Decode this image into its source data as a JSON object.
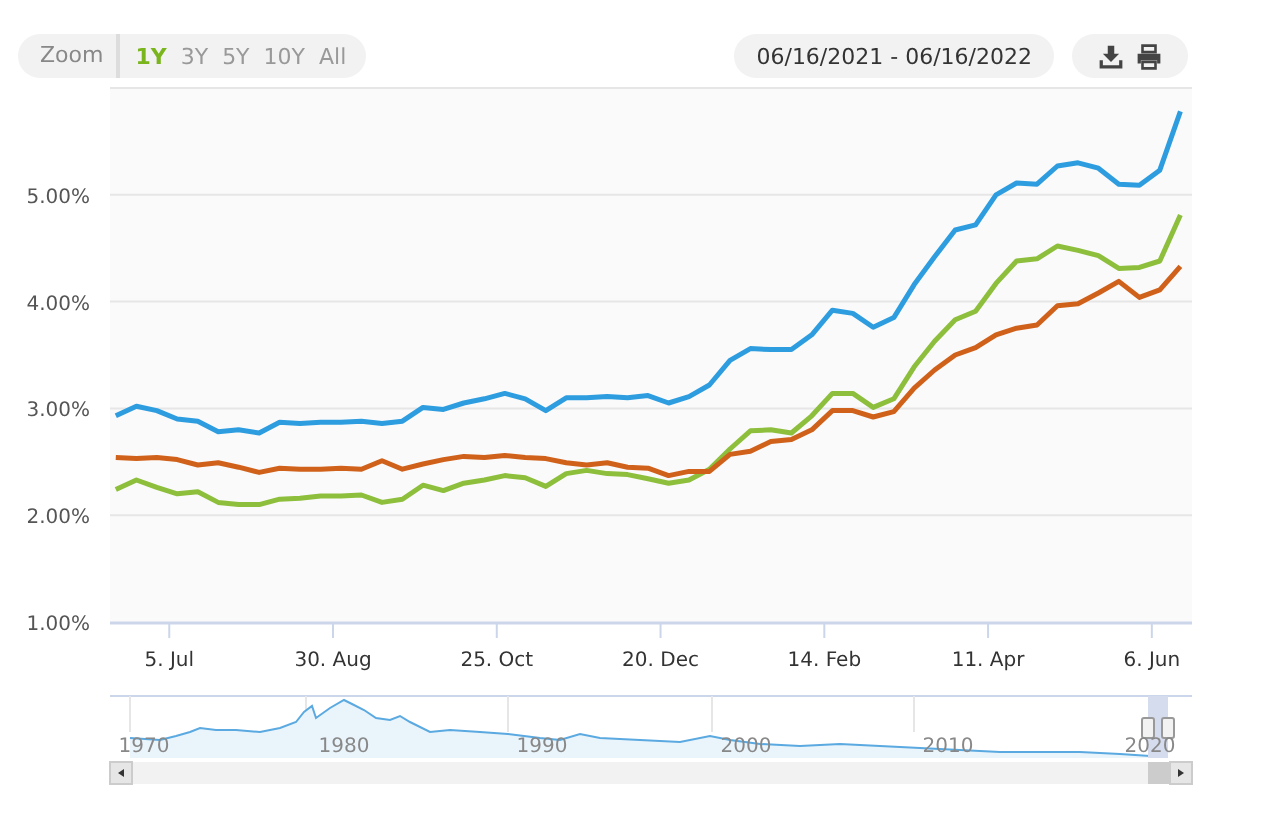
{
  "toolbar": {
    "zoom_label": "Zoom",
    "ranges": [
      {
        "label": "1Y",
        "selected": true
      },
      {
        "label": "3Y",
        "selected": false
      },
      {
        "label": "5Y",
        "selected": false
      },
      {
        "label": "10Y",
        "selected": false
      },
      {
        "label": "All",
        "selected": false
      }
    ],
    "date_range": "06/16/2021 - 06/16/2022"
  },
  "chart": {
    "chart_data": {
      "type": "line",
      "categories": [
        null,
        null,
        null,
        "5. Jul",
        null,
        null,
        null,
        null,
        null,
        null,
        null,
        "30. Aug",
        null,
        null,
        null,
        null,
        null,
        null,
        null,
        "25. Oct",
        null,
        null,
        null,
        null,
        null,
        null,
        null,
        "20. Dec",
        null,
        null,
        null,
        null,
        null,
        null,
        null,
        "14. Feb",
        null,
        null,
        null,
        null,
        null,
        null,
        null,
        "11. Apr",
        null,
        null,
        null,
        null,
        null,
        null,
        null,
        "6. Jun",
        null
      ],
      "series": [
        {
          "color": "#2d9de0",
          "values": [
            2.93,
            3.02,
            2.98,
            2.9,
            2.88,
            2.78,
            2.8,
            2.77,
            2.87,
            2.86,
            2.87,
            2.87,
            2.88,
            2.86,
            2.88,
            3.01,
            2.99,
            3.05,
            3.09,
            3.14,
            3.09,
            2.98,
            3.1,
            3.1,
            3.11,
            3.1,
            3.12,
            3.05,
            3.11,
            3.22,
            3.45,
            3.56,
            3.55,
            3.55,
            3.69,
            3.92,
            3.89,
            3.76,
            3.85,
            4.16,
            4.42,
            4.67,
            4.72,
            5.0,
            5.11,
            5.1,
            5.27,
            5.3,
            5.25,
            5.1,
            5.09,
            5.23,
            5.78
          ]
        },
        {
          "color": "#8dbf3c",
          "values": [
            2.24,
            2.33,
            2.26,
            2.2,
            2.22,
            2.12,
            2.1,
            2.1,
            2.15,
            2.16,
            2.18,
            2.18,
            2.19,
            2.12,
            2.15,
            2.28,
            2.23,
            2.3,
            2.33,
            2.37,
            2.35,
            2.27,
            2.39,
            2.42,
            2.39,
            2.38,
            2.34,
            2.3,
            2.33,
            2.43,
            2.62,
            2.79,
            2.8,
            2.77,
            2.93,
            3.14,
            3.14,
            3.01,
            3.09,
            3.39,
            3.63,
            3.83,
            3.91,
            4.17,
            4.38,
            4.4,
            4.52,
            4.48,
            4.43,
            4.31,
            4.32,
            4.38,
            4.81
          ]
        },
        {
          "color": "#d0611b",
          "values": [
            2.54,
            2.53,
            2.54,
            2.52,
            2.47,
            2.49,
            2.45,
            2.4,
            2.44,
            2.43,
            2.43,
            2.44,
            2.43,
            2.51,
            2.43,
            2.48,
            2.52,
            2.55,
            2.54,
            2.56,
            2.54,
            2.53,
            2.49,
            2.47,
            2.49,
            2.45,
            2.44,
            2.37,
            2.41,
            2.41,
            2.57,
            2.6,
            2.69,
            2.71,
            2.8,
            2.98,
            2.98,
            2.92,
            2.97,
            3.19,
            3.36,
            3.5,
            3.57,
            3.69,
            3.75,
            3.78,
            3.96,
            3.98,
            4.08,
            4.19,
            4.04,
            4.11,
            4.33
          ]
        }
      ],
      "ylim": [
        1,
        6
      ],
      "grid": true,
      "yticks": [
        {
          "value": 1,
          "label": "1.00%"
        },
        {
          "value": 2,
          "label": "2.00%"
        },
        {
          "value": 3,
          "label": "3.00%"
        },
        {
          "value": 4,
          "label": "4.00%"
        },
        {
          "value": 5,
          "label": "5.00%"
        }
      ]
    }
  },
  "navigator": {
    "years": [
      "1970",
      "1980",
      "1990",
      "2000",
      "2010",
      "2020"
    ]
  }
}
